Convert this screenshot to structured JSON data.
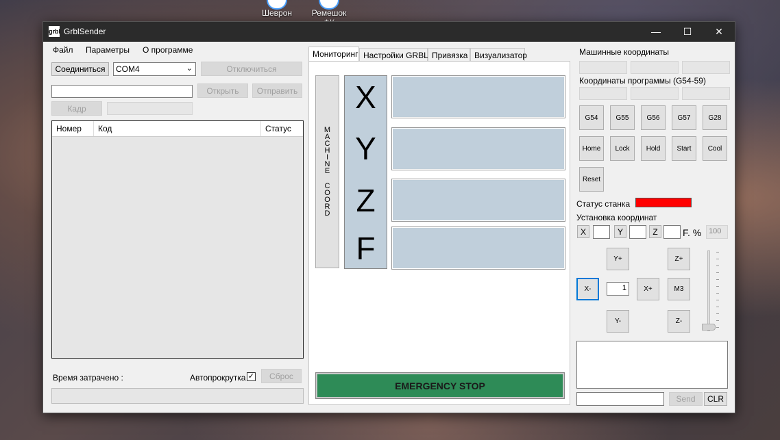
{
  "desktop": {
    "icons": [
      {
        "label": "Шеврон"
      },
      {
        "label": "Ремешок ФК"
      }
    ]
  },
  "window": {
    "title": "GrblSender",
    "app_icon_text": "grbl",
    "controls": {
      "minimize": "—",
      "maximize": "☐",
      "close": "✕"
    }
  },
  "menu": [
    "Файл",
    "Параметры",
    "О программе"
  ],
  "left": {
    "connect_button": "Соединиться",
    "port_value": "COM4",
    "disconnect_button": "Отключиться",
    "file_path": "",
    "open_button": "Открыть",
    "send_button": "Отправить",
    "frame_button": "Кадр",
    "frame_value": "",
    "table": {
      "columns": [
        "Номер",
        "Код",
        "Статус"
      ],
      "rows": []
    },
    "time_label": "Время затрачено :",
    "autoscroll_label": "Автопрокрутка",
    "autoscroll_checked": true,
    "reset_button": "Сброс",
    "progress": 0
  },
  "tabs": [
    "Мониторинг",
    "Настройки GRBL",
    "Привязка",
    "Визуализатор"
  ],
  "monitor": {
    "machine_coord_letters": [
      "M",
      "A",
      "C",
      "H",
      "I",
      "N",
      "E",
      "",
      "C",
      "O",
      "O",
      "R",
      "D"
    ],
    "axes": [
      "X",
      "Y",
      "Z",
      "F"
    ],
    "estop": "EMERGENCY STOP"
  },
  "right": {
    "machine_coords_label": "Машинные координаты",
    "program_coords_label": "Координаты программы (G54-59)",
    "wcs_buttons": [
      "G54",
      "G55",
      "G56",
      "G57",
      "G28"
    ],
    "action_buttons": [
      "Home",
      "Lock",
      "Hold",
      "Start",
      "Cool"
    ],
    "reset_button": "Reset",
    "status_label": "Статус станка",
    "status_color": "#ff0000",
    "set_coords_label": "Установка координат",
    "set_x": "X",
    "set_y": "Y",
    "set_z": "Z",
    "feed_label": "F. %",
    "feed_value": "100",
    "jog": {
      "y_plus": "Y+",
      "z_plus": "Z+",
      "x_minus": "X-",
      "step": "1",
      "x_plus": "X+",
      "m3": "M3",
      "y_minus": "Y-",
      "z_minus": "Z-"
    },
    "console_text": "",
    "command_input": "",
    "send_button": "Send",
    "clr_button": "CLR"
  },
  "colors": {
    "axis_fill": "#c0cfdb",
    "estop": "#2e8b57",
    "titlebar": "#2b2b2b"
  }
}
